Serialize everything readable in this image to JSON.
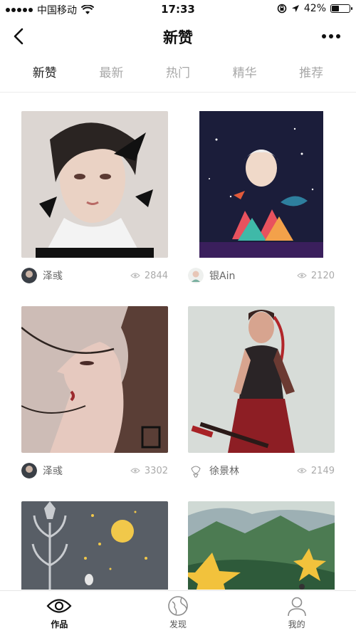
{
  "status_bar": {
    "carrier": "中国移动",
    "time": "17:33",
    "battery_percent": "42%",
    "battery_level": 0.42,
    "icons": [
      "wifi-icon",
      "location-lock-icon",
      "location-arrow-icon",
      "battery-icon"
    ]
  },
  "nav": {
    "title": "新赞",
    "back_icon": "chevron-left-icon",
    "more_icon": "ellipsis-icon"
  },
  "tabs": [
    {
      "label": "新赞",
      "active": true
    },
    {
      "label": "最新",
      "active": false
    },
    {
      "label": "热门",
      "active": false
    },
    {
      "label": "精华",
      "active": false
    },
    {
      "label": "推荐",
      "active": false
    }
  ],
  "cards": [
    {
      "author": "泽彧",
      "views": "2844",
      "image": "portrait-boy-feathers"
    },
    {
      "author": "银Ain",
      "views": "2120",
      "image": "starry-boy-illustration"
    },
    {
      "author": "泽彧",
      "views": "3302",
      "image": "woman-profile-thorns"
    },
    {
      "author": "徐景林",
      "views": "2149",
      "image": "warrior-woman-katana"
    },
    {
      "author": "",
      "views": "",
      "image": "moon-flower-night"
    },
    {
      "author": "",
      "views": "",
      "image": "mountain-star-landscape"
    }
  ],
  "bottom_nav": [
    {
      "label": "作品",
      "icon": "eye-icon",
      "active": true
    },
    {
      "label": "发现",
      "icon": "globe-icon",
      "active": false
    },
    {
      "label": "我的",
      "icon": "user-icon",
      "active": false
    }
  ]
}
